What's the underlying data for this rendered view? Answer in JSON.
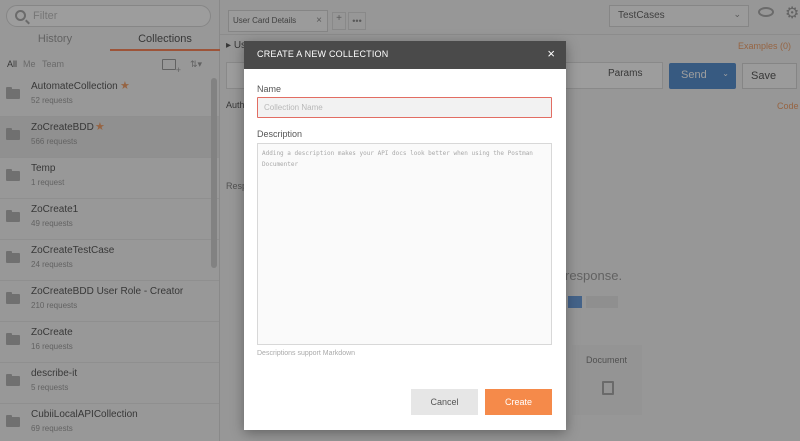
{
  "sidebar": {
    "filter_placeholder": "Filter",
    "tabs": {
      "history": "History",
      "collections": "Collections"
    },
    "scopes": {
      "all": "All",
      "me": "Me",
      "team": "Team"
    },
    "collections": [
      {
        "name": "AutomateCollection",
        "count": "52 requests",
        "starred": true
      },
      {
        "name": "ZoCreateBDD",
        "count": "566 requests",
        "starred": true
      },
      {
        "name": "Temp",
        "count": "1 request",
        "starred": false
      },
      {
        "name": "ZoCreate1",
        "count": "49 requests",
        "starred": false
      },
      {
        "name": "ZoCreateTestCase",
        "count": "24 requests",
        "starred": false
      },
      {
        "name": "ZoCreateBDD User Role - Creator",
        "count": "210 requests",
        "starred": false
      },
      {
        "name": "ZoCreate",
        "count": "16 requests",
        "starred": false
      },
      {
        "name": "describe-it",
        "count": "5 requests",
        "starred": false
      },
      {
        "name": "CubiiLocalAPICollection",
        "count": "69 requests",
        "starred": false
      }
    ]
  },
  "main": {
    "tab_label": "User Card Details",
    "request_name": "Us",
    "environment": "TestCases",
    "examples": "Examples (0)",
    "params": "Params",
    "send": "Send",
    "save": "Save",
    "code": "Code",
    "subtab": "Auth",
    "resp_label": "Resp",
    "resp_hint": "response.",
    "document": "Document"
  },
  "modal": {
    "title": "CREATE A NEW COLLECTION",
    "close": "×",
    "name_label": "Name",
    "name_placeholder": "Collection Name",
    "description_label": "Description",
    "description_placeholder": "Adding a description makes your API docs look better when using the Postman Documenter",
    "markdown_hint": "Descriptions support Markdown",
    "cancel": "Cancel",
    "create": "Create"
  },
  "colors": {
    "accent": "#ff6c37",
    "send": "#3379c7",
    "create": "#f58a4a",
    "modal_header": "#4a4a4a",
    "input_error_border": "#e26d63"
  }
}
